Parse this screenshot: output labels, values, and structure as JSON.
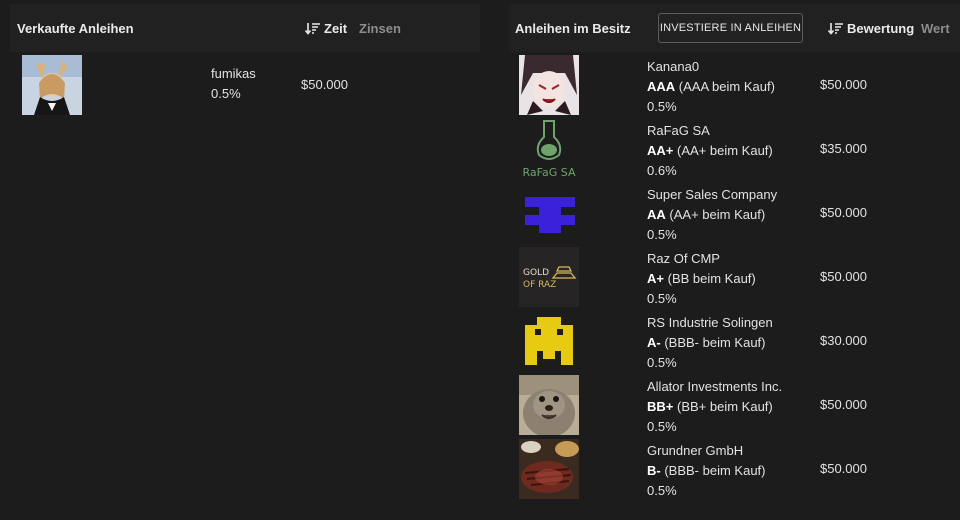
{
  "sold": {
    "title": "Verkaufte Anleihen",
    "sort_label": "Zeit",
    "alt_sort_label": "Zinsen",
    "items": [
      {
        "name": "fumikas",
        "rate": "0.5%",
        "amount": "$50.000",
        "image": "anime-avatar"
      }
    ]
  },
  "owned": {
    "title": "Anleihen im Besitz",
    "invest_button": "INVESTIERE IN ANLEIHEN",
    "sort_label": "Bewertung",
    "alt_sort_label": "Wert",
    "items": [
      {
        "name": "Kanana0",
        "rating": "AAA",
        "purchase_rating": "(AAA beim Kauf)",
        "rate": "0.5%",
        "value": "$50.000",
        "logo": "anime-avatar"
      },
      {
        "name": "RaFaG SA",
        "rating": "AA+",
        "purchase_rating": "(AA+ beim Kauf)",
        "rate": "0.6%",
        "value": "$35.000",
        "logo": "flask-logo",
        "logo_text": "RaFaG SA"
      },
      {
        "name": "Super Sales Company",
        "rating": "AA",
        "purchase_rating": "(AA+ beim Kauf)",
        "rate": "0.5%",
        "value": "$50.000",
        "logo": "blue-pixel-logo"
      },
      {
        "name": "Raz Of CMP",
        "rating": "A+",
        "purchase_rating": "(BB beim Kauf)",
        "rate": "0.5%",
        "value": "$50.000",
        "logo": "gold-bar-logo",
        "logo_text_1": "GOLD",
        "logo_text_2": "OF RAZ"
      },
      {
        "name": "RS Industrie Solingen",
        "rating": "A-",
        "purchase_rating": "(BBB- beim Kauf)",
        "rate": "0.5%",
        "value": "$30.000",
        "logo": "yellow-pixel-logo"
      },
      {
        "name": "Allator Investments Inc.",
        "rating": "BB+",
        "purchase_rating": "(BB+ beim Kauf)",
        "rate": "0.5%",
        "value": "$50.000",
        "logo": "seal-photo"
      },
      {
        "name": "Grundner GmbH",
        "rating": "B-",
        "purchase_rating": "(BBB- beim Kauf)",
        "rate": "0.5%",
        "value": "$50.000",
        "logo": "steak-photo"
      }
    ]
  },
  "colors": {
    "background": "#1c1c1c",
    "header": "#212121",
    "muted_text": "#8d8d8d",
    "blue_logo": "#3a22d8",
    "yellow_logo": "#e6cb12",
    "flask_green": "#6fa36b"
  }
}
